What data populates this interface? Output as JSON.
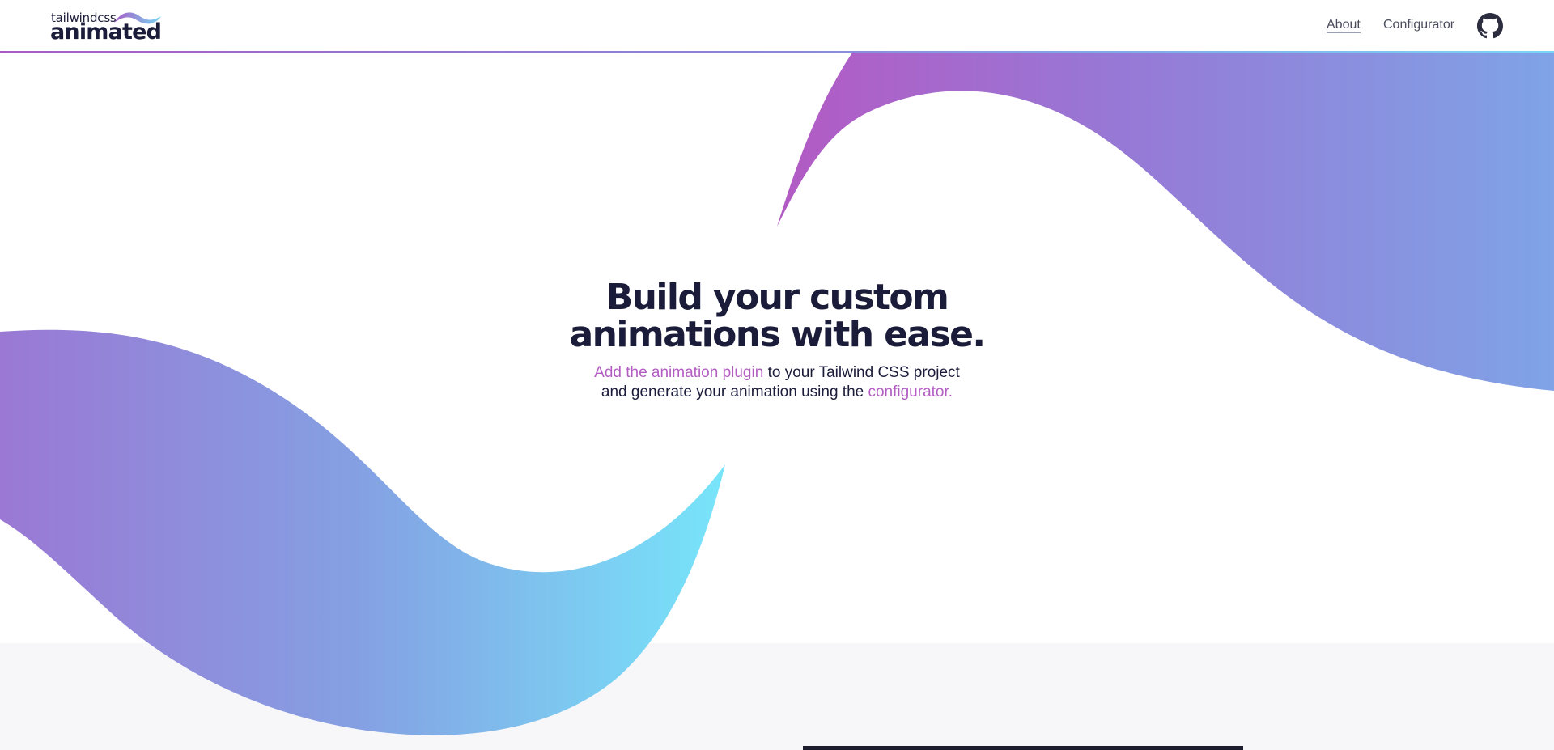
{
  "header": {
    "logo_small": "tailwindcss",
    "logo_big": "animated",
    "nav": [
      {
        "label": "About"
      },
      {
        "label": "Configurator"
      }
    ],
    "github_icon": "github-icon"
  },
  "hero": {
    "title_line1": "Build your custom",
    "title_line2": "animations with ease.",
    "sub_link1": "Add the animation plugin",
    "sub_text1": " to your Tailwind CSS project",
    "sub_text2": "and generate your animation using the ",
    "sub_link2": "configurator."
  },
  "colors": {
    "ink": "#1b1c3a",
    "accent": "#b35dc3",
    "wave_purple": "#a85bc6",
    "wave_blue": "#8a86db",
    "wave_cyan": "#79e3f8",
    "section_bg": "#f7f7f9"
  }
}
